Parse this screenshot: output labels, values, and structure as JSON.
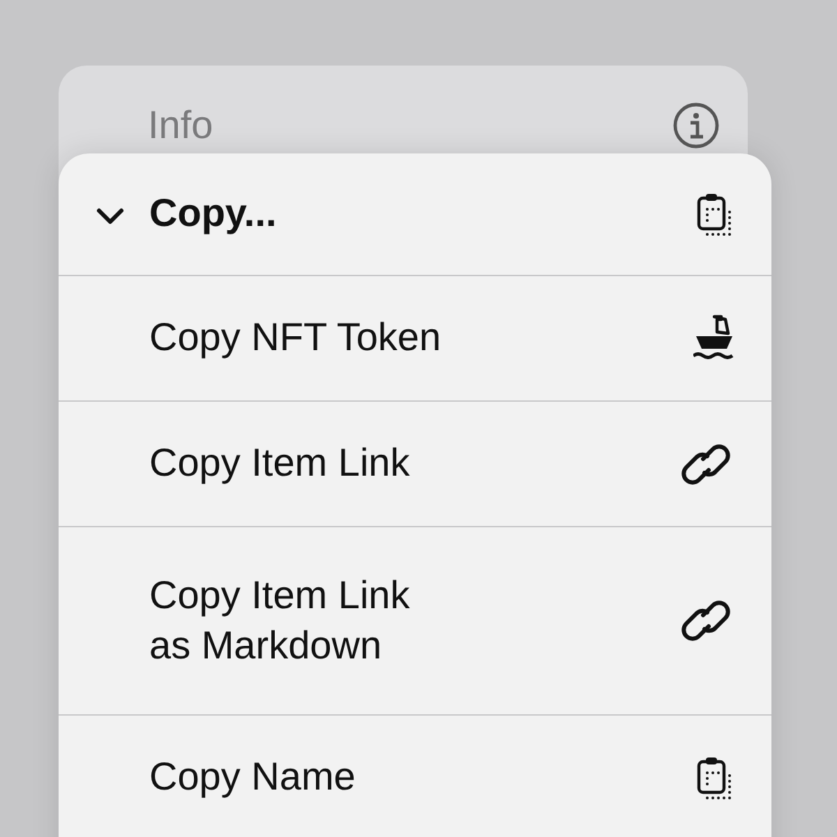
{
  "back_menu": {
    "title": "Info"
  },
  "menu": {
    "header": {
      "title": "Copy...",
      "expanded": true
    },
    "items": [
      {
        "label": "Copy NFT Token",
        "kind": "boat"
      },
      {
        "label": "Copy Item Link",
        "kind": "link"
      },
      {
        "label": "Copy Item Link\nas Markdown",
        "kind": "link"
      },
      {
        "label": "Copy Name",
        "kind": "clipboard"
      }
    ]
  }
}
